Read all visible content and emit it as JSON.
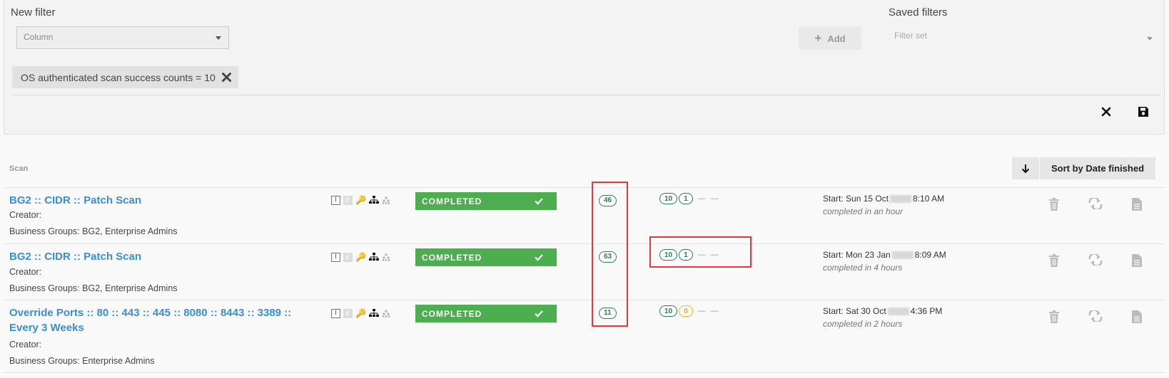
{
  "filter": {
    "new_filter_label": "New filter",
    "column_placeholder": "Column",
    "add_label": "Add",
    "saved_filters_label": "Saved filters",
    "filter_set_placeholder": "Filter set",
    "active_chip": "OS authenticated scan success counts = 10"
  },
  "table": {
    "scan_header": "Scan",
    "sort_label": "Sort by Date finished"
  },
  "rows": [
    {
      "title": "BG2 :: CIDR :: Patch Scan",
      "creator": "Creator:",
      "business_groups": "Business Groups: BG2, Enterprise Admins",
      "status": "COMPLETED",
      "count": "46",
      "pill_a": "10",
      "pill_b": "1",
      "start_prefix": "Start: Sun 15 Oct",
      "start_time": "8:10 AM",
      "duration": "completed in an hour"
    },
    {
      "title": "BG2 :: CIDR :: Patch Scan",
      "creator": "Creator:",
      "business_groups": "Business Groups: BG2, Enterprise Admins",
      "status": "COMPLETED",
      "count": "63",
      "pill_a": "10",
      "pill_b": "1",
      "start_prefix": "Start: Mon 23 Jan",
      "start_time": "8:09 AM",
      "duration": "completed in 4 hours"
    },
    {
      "title": "Override Ports :: 80 :: 443 :: 445 :: 8080 :: 8443 :: 3389 :: Every 3 Weeks",
      "creator": "Creator:",
      "business_groups": "Business Groups: Enterprise Admins",
      "status": "COMPLETED",
      "count": "11",
      "pill_a": "10",
      "pill_b": "0",
      "start_prefix": "Start: Sat 30 Oct",
      "start_time": "4:36 PM",
      "duration": "completed in 2 hours"
    }
  ],
  "colors": {
    "link": "#3a8ed3",
    "completed": "#4cae4f",
    "pill_green": "#2d7a5d",
    "pill_yellow": "#f0b90f",
    "highlight": "#e53935"
  },
  "icons": [
    "chevron-down-icon",
    "plus-icon",
    "close-icon",
    "save-icon",
    "arrow-down-icon",
    "key-icon",
    "hierarchy-icon",
    "check-icon",
    "trash-icon",
    "rescan-icon",
    "report-icon"
  ]
}
